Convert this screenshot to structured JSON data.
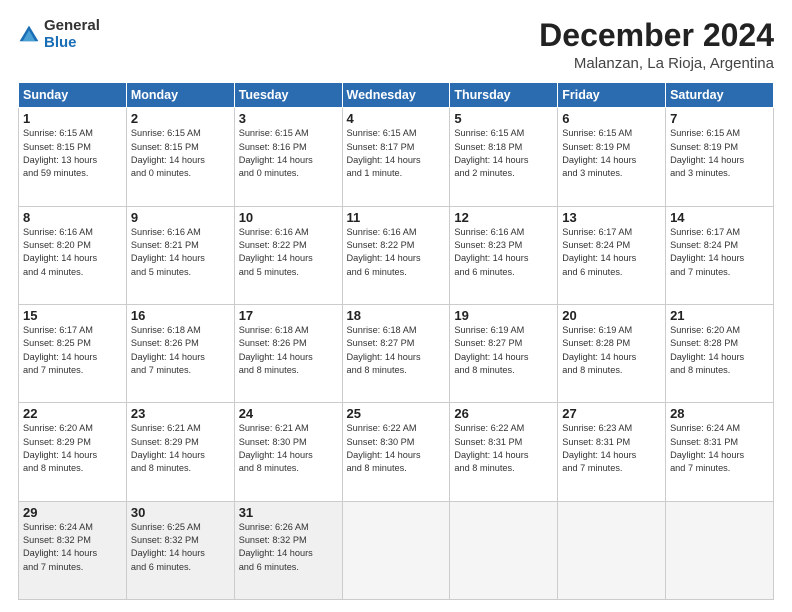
{
  "header": {
    "logo_general": "General",
    "logo_blue": "Blue",
    "month_title": "December 2024",
    "subtitle": "Malanzan, La Rioja, Argentina"
  },
  "days_of_week": [
    "Sunday",
    "Monday",
    "Tuesday",
    "Wednesday",
    "Thursday",
    "Friday",
    "Saturday"
  ],
  "weeks": [
    [
      {
        "day": "1",
        "info": "Sunrise: 6:15 AM\nSunset: 8:15 PM\nDaylight: 13 hours\nand 59 minutes."
      },
      {
        "day": "2",
        "info": "Sunrise: 6:15 AM\nSunset: 8:15 PM\nDaylight: 14 hours\nand 0 minutes."
      },
      {
        "day": "3",
        "info": "Sunrise: 6:15 AM\nSunset: 8:16 PM\nDaylight: 14 hours\nand 0 minutes."
      },
      {
        "day": "4",
        "info": "Sunrise: 6:15 AM\nSunset: 8:17 PM\nDaylight: 14 hours\nand 1 minute."
      },
      {
        "day": "5",
        "info": "Sunrise: 6:15 AM\nSunset: 8:18 PM\nDaylight: 14 hours\nand 2 minutes."
      },
      {
        "day": "6",
        "info": "Sunrise: 6:15 AM\nSunset: 8:19 PM\nDaylight: 14 hours\nand 3 minutes."
      },
      {
        "day": "7",
        "info": "Sunrise: 6:15 AM\nSunset: 8:19 PM\nDaylight: 14 hours\nand 3 minutes."
      }
    ],
    [
      {
        "day": "8",
        "info": "Sunrise: 6:16 AM\nSunset: 8:20 PM\nDaylight: 14 hours\nand 4 minutes."
      },
      {
        "day": "9",
        "info": "Sunrise: 6:16 AM\nSunset: 8:21 PM\nDaylight: 14 hours\nand 5 minutes."
      },
      {
        "day": "10",
        "info": "Sunrise: 6:16 AM\nSunset: 8:22 PM\nDaylight: 14 hours\nand 5 minutes."
      },
      {
        "day": "11",
        "info": "Sunrise: 6:16 AM\nSunset: 8:22 PM\nDaylight: 14 hours\nand 6 minutes."
      },
      {
        "day": "12",
        "info": "Sunrise: 6:16 AM\nSunset: 8:23 PM\nDaylight: 14 hours\nand 6 minutes."
      },
      {
        "day": "13",
        "info": "Sunrise: 6:17 AM\nSunset: 8:24 PM\nDaylight: 14 hours\nand 6 minutes."
      },
      {
        "day": "14",
        "info": "Sunrise: 6:17 AM\nSunset: 8:24 PM\nDaylight: 14 hours\nand 7 minutes."
      }
    ],
    [
      {
        "day": "15",
        "info": "Sunrise: 6:17 AM\nSunset: 8:25 PM\nDaylight: 14 hours\nand 7 minutes."
      },
      {
        "day": "16",
        "info": "Sunrise: 6:18 AM\nSunset: 8:26 PM\nDaylight: 14 hours\nand 7 minutes."
      },
      {
        "day": "17",
        "info": "Sunrise: 6:18 AM\nSunset: 8:26 PM\nDaylight: 14 hours\nand 8 minutes."
      },
      {
        "day": "18",
        "info": "Sunrise: 6:18 AM\nSunset: 8:27 PM\nDaylight: 14 hours\nand 8 minutes."
      },
      {
        "day": "19",
        "info": "Sunrise: 6:19 AM\nSunset: 8:27 PM\nDaylight: 14 hours\nand 8 minutes."
      },
      {
        "day": "20",
        "info": "Sunrise: 6:19 AM\nSunset: 8:28 PM\nDaylight: 14 hours\nand 8 minutes."
      },
      {
        "day": "21",
        "info": "Sunrise: 6:20 AM\nSunset: 8:28 PM\nDaylight: 14 hours\nand 8 minutes."
      }
    ],
    [
      {
        "day": "22",
        "info": "Sunrise: 6:20 AM\nSunset: 8:29 PM\nDaylight: 14 hours\nand 8 minutes."
      },
      {
        "day": "23",
        "info": "Sunrise: 6:21 AM\nSunset: 8:29 PM\nDaylight: 14 hours\nand 8 minutes."
      },
      {
        "day": "24",
        "info": "Sunrise: 6:21 AM\nSunset: 8:30 PM\nDaylight: 14 hours\nand 8 minutes."
      },
      {
        "day": "25",
        "info": "Sunrise: 6:22 AM\nSunset: 8:30 PM\nDaylight: 14 hours\nand 8 minutes."
      },
      {
        "day": "26",
        "info": "Sunrise: 6:22 AM\nSunset: 8:31 PM\nDaylight: 14 hours\nand 8 minutes."
      },
      {
        "day": "27",
        "info": "Sunrise: 6:23 AM\nSunset: 8:31 PM\nDaylight: 14 hours\nand 7 minutes."
      },
      {
        "day": "28",
        "info": "Sunrise: 6:24 AM\nSunset: 8:31 PM\nDaylight: 14 hours\nand 7 minutes."
      }
    ],
    [
      {
        "day": "29",
        "info": "Sunrise: 6:24 AM\nSunset: 8:32 PM\nDaylight: 14 hours\nand 7 minutes."
      },
      {
        "day": "30",
        "info": "Sunrise: 6:25 AM\nSunset: 8:32 PM\nDaylight: 14 hours\nand 6 minutes."
      },
      {
        "day": "31",
        "info": "Sunrise: 6:26 AM\nSunset: 8:32 PM\nDaylight: 14 hours\nand 6 minutes."
      },
      {
        "day": "",
        "info": ""
      },
      {
        "day": "",
        "info": ""
      },
      {
        "day": "",
        "info": ""
      },
      {
        "day": "",
        "info": ""
      }
    ]
  ]
}
